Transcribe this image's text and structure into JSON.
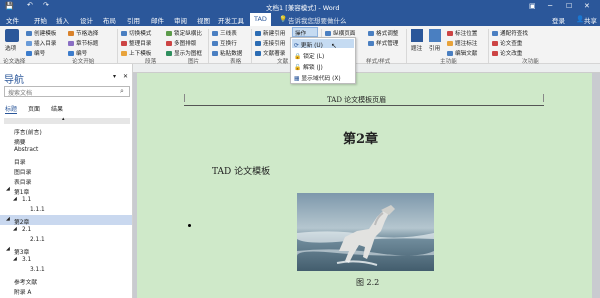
{
  "title": "文档1 [兼容模式] - Word",
  "quick_access": {
    "save": "💾",
    "undo": "↶",
    "redo": "↷"
  },
  "window_buttons": {
    "ribbon_opts": "▣",
    "minimize": "─",
    "maximize": "☐",
    "close": "✕"
  },
  "tabs": [
    "文件",
    "开始",
    "插入",
    "设计",
    "布局",
    "引用",
    "邮件",
    "审阅",
    "视图",
    "开发工具",
    "TAD"
  ],
  "tell_me": "告诉我您想要做什么",
  "user": {
    "login": "登录",
    "share": "共享"
  },
  "ribbon": {
    "groups": [
      "论文选择",
      "论文开始",
      "段落",
      "图片",
      "表格",
      "文献",
      "样式/样式",
      "主功能",
      "次功能"
    ],
    "select_label": "选项",
    "items": {
      "c1": [
        "创建模板",
        "插入目录",
        "编号"
      ],
      "c2": [
        "节格选择",
        "章节标题",
        "编号"
      ],
      "c3": [
        "切换模式",
        "整理目录",
        "上下模板"
      ],
      "c4": [
        "锁定纵横比",
        "多图排版",
        "显示为图框"
      ],
      "c5": [
        "三线表",
        "互换行",
        "粘贴数据"
      ],
      "c6": [
        "新建引用",
        "连接引用",
        "文献著录"
      ],
      "c7": [
        "操作"
      ],
      "c8": [
        "纵横页面",
        "格式调整",
        "样式管理"
      ],
      "c9": [
        "题注",
        "引用"
      ],
      "c10": [
        "标注位置",
        "题注标注",
        "编辑文献"
      ],
      "c11": [
        "通配符查找",
        "论文查重",
        "论文改重"
      ]
    }
  },
  "dropdown": {
    "items": [
      "更新 (U)",
      "锁定 (L)",
      "解锁 (J)",
      "显示域代码 (X)"
    ]
  },
  "nav": {
    "title": "导航",
    "search_placeholder": "搜索文档",
    "search_icon": "⌕",
    "tabs": [
      "标题",
      "页面",
      "结果"
    ],
    "items": [
      "序言(前言)",
      "摘要",
      "Abstract",
      "目录",
      "图目录",
      "表目录",
      "第1章",
      "1.1",
      "1.1.1",
      "第2章",
      "2.1",
      "2.1.1",
      "第3章",
      "3.1",
      "3.1.1",
      "参考文献",
      "附录 A"
    ]
  },
  "document": {
    "header": "TAD 论文模板页眉",
    "chapter": "第2章",
    "paragraph": "TAD 论文模板",
    "caption": "图 2.2"
  },
  "colors": {
    "brand": "#2b579a",
    "page": "#cfe9c9",
    "nav_selected": "#c9d8ef"
  }
}
